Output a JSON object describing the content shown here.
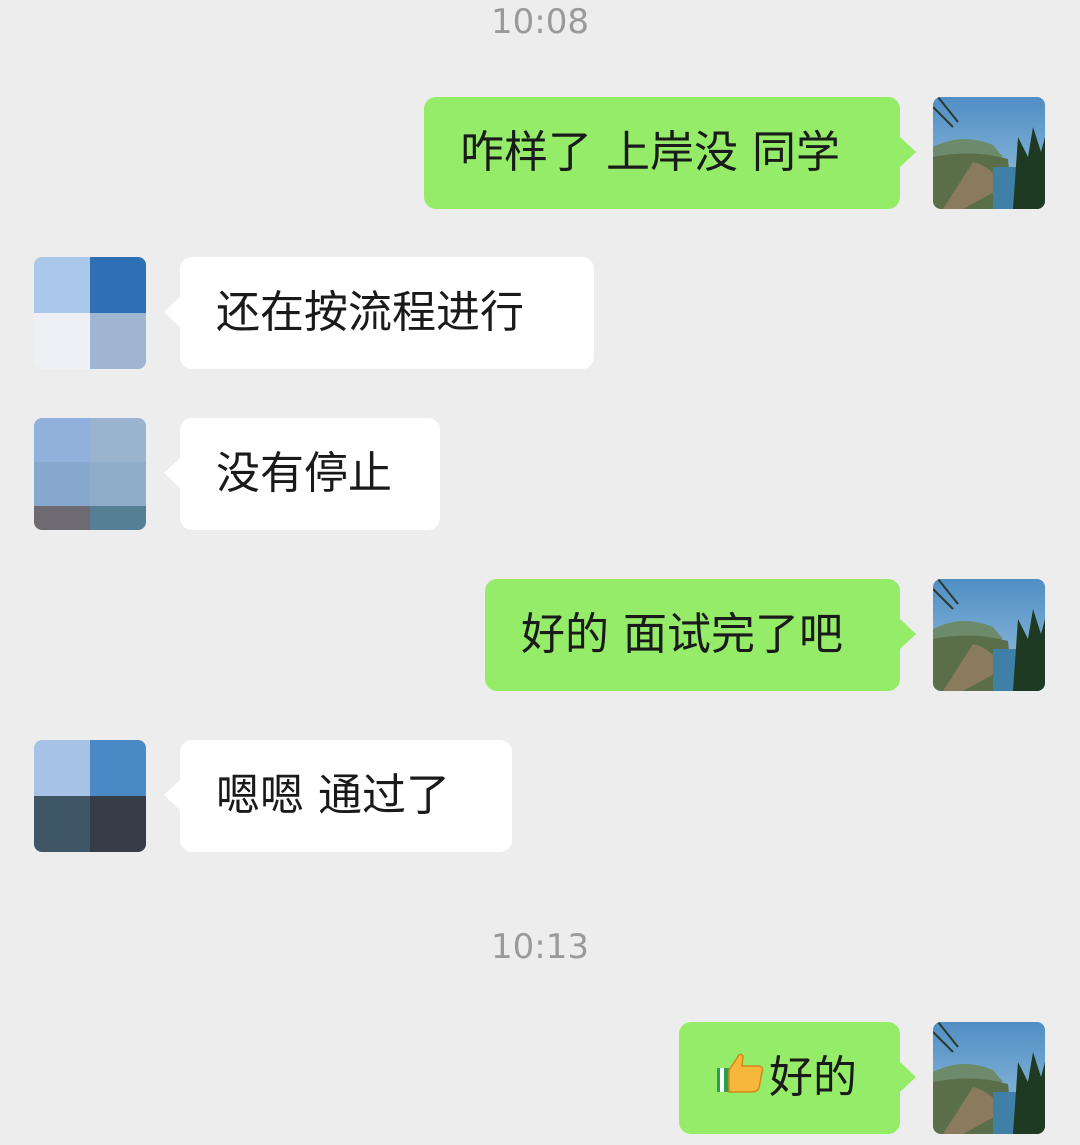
{
  "timestamps": [
    "10:08",
    "10:13"
  ],
  "messages": [
    {
      "side": "right",
      "text": "咋样了 上岸没 同学"
    },
    {
      "side": "left",
      "text": "还在按流程进行"
    },
    {
      "side": "left",
      "text": "没有停止"
    },
    {
      "side": "right",
      "text": "好的 面试完了吧"
    },
    {
      "side": "left",
      "text": "嗯嗯  通过了"
    },
    {
      "side": "right",
      "text": "好的",
      "emoji": "thumbs-up-icon"
    }
  ],
  "colors": {
    "background": "#ededed",
    "my_bubble": "#95ec69",
    "other_bubble": "#ffffff",
    "timestamp": "#9a9a9a"
  }
}
